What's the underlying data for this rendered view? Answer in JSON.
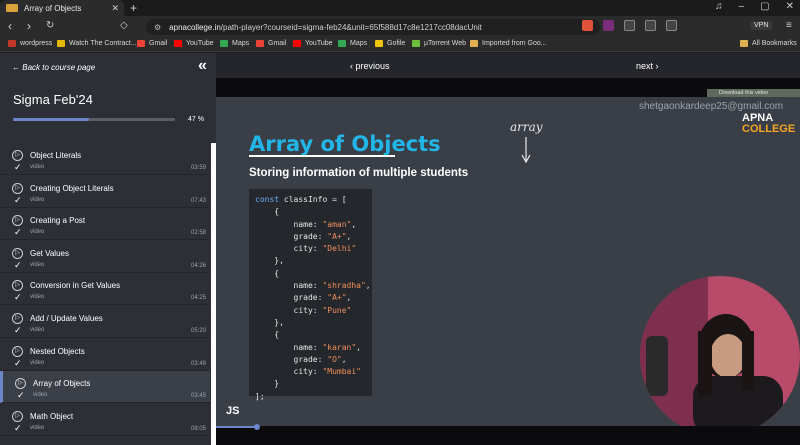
{
  "browser": {
    "tab_title": "Array of Objects",
    "url_host": "apnacollege.in",
    "url_path": "/path-player?courseid=sigma-feb24&unit=65f588d17c8e1217cc08dacUnit",
    "vpn_label": "VPN",
    "bookmarks": [
      {
        "label": "wordpress",
        "color": "#c0392b"
      },
      {
        "label": "Watch The Contract...",
        "color": "#e6b800"
      },
      {
        "label": "Gmail",
        "color": "#ea4335"
      },
      {
        "label": "YouTube",
        "color": "#ff0000"
      },
      {
        "label": "Maps",
        "color": "#34a853"
      },
      {
        "label": "Gmail",
        "color": "#ea4335"
      },
      {
        "label": "YouTube",
        "color": "#ff0000"
      },
      {
        "label": "Maps",
        "color": "#34a853"
      },
      {
        "label": "Gofile",
        "color": "#f1c40f"
      },
      {
        "label": "µTorrent Web",
        "color": "#6fbf3b"
      },
      {
        "label": "Imported from Goo...",
        "color": "#e0b050"
      }
    ],
    "all_bookmarks": "All Bookmarks"
  },
  "sidebar": {
    "back_label": "Back to course page",
    "course_title": "Sigma Feb'24",
    "progress_percent": 47,
    "progress_label": "47 %",
    "items": [
      {
        "title": "Object Literals",
        "kind": "video",
        "duration": "03:59",
        "active": false
      },
      {
        "title": "Creating Object Literals",
        "kind": "video",
        "duration": "07:43",
        "active": false
      },
      {
        "title": "Creating a Post",
        "kind": "video",
        "duration": "02:58",
        "active": false
      },
      {
        "title": "Get Values",
        "kind": "video",
        "duration": "04:26",
        "active": false
      },
      {
        "title": "Conversion in Get Values",
        "kind": "video",
        "duration": "04:25",
        "active": false
      },
      {
        "title": "Add / Update Values",
        "kind": "video",
        "duration": "05:20",
        "active": false
      },
      {
        "title": "Nested Objects",
        "kind": "video",
        "duration": "03:48",
        "active": false
      },
      {
        "title": "Array of Objects",
        "kind": "video",
        "duration": "03:45",
        "active": true
      },
      {
        "title": "Math Object",
        "kind": "video",
        "duration": "08:05",
        "active": false
      }
    ]
  },
  "player": {
    "prev_label": "‹ previous",
    "next_label": "next ›",
    "download_label": "Download this video",
    "seek_fraction": 0.07
  },
  "slide": {
    "email_watermark": "shetgaonkardeep25@gmail.com",
    "logo_line1": "APNA",
    "logo_line2": "COLLEGE",
    "title": "Array of Objects",
    "subtitle": "Storing information of multiple students",
    "handwriting": "array",
    "footer": "JS",
    "code_lines": [
      [
        {
          "t": "const ",
          "c": "kw"
        },
        {
          "t": "classInfo = [",
          "c": ""
        }
      ],
      [
        {
          "t": "    {",
          "c": ""
        }
      ],
      [
        {
          "t": "        name: ",
          "c": ""
        },
        {
          "t": "\"aman\"",
          "c": "st"
        },
        {
          "t": ",",
          "c": ""
        }
      ],
      [
        {
          "t": "        grade: ",
          "c": ""
        },
        {
          "t": "\"A+\"",
          "c": "st"
        },
        {
          "t": ",",
          "c": ""
        }
      ],
      [
        {
          "t": "        city: ",
          "c": ""
        },
        {
          "t": "\"Delhi\"",
          "c": "st"
        }
      ],
      [
        {
          "t": "    },",
          "c": ""
        }
      ],
      [
        {
          "t": "    {",
          "c": ""
        }
      ],
      [
        {
          "t": "        name: ",
          "c": ""
        },
        {
          "t": "\"shradha\"",
          "c": "st"
        },
        {
          "t": ",",
          "c": ""
        }
      ],
      [
        {
          "t": "        grade: ",
          "c": ""
        },
        {
          "t": "\"A+\"",
          "c": "st"
        },
        {
          "t": ",",
          "c": ""
        }
      ],
      [
        {
          "t": "        city: ",
          "c": ""
        },
        {
          "t": "\"Pune\"",
          "c": "st"
        }
      ],
      [
        {
          "t": "    },",
          "c": ""
        }
      ],
      [
        {
          "t": "    {",
          "c": ""
        }
      ],
      [
        {
          "t": "        name: ",
          "c": ""
        },
        {
          "t": "\"karan\"",
          "c": "st"
        },
        {
          "t": ",",
          "c": ""
        }
      ],
      [
        {
          "t": "        grade: ",
          "c": ""
        },
        {
          "t": "\"O\"",
          "c": "st"
        },
        {
          "t": ",",
          "c": ""
        }
      ],
      [
        {
          "t": "        city: ",
          "c": ""
        },
        {
          "t": "\"Mumbai\"",
          "c": "st"
        }
      ],
      [
        {
          "t": "    }",
          "c": ""
        }
      ],
      [
        {
          "t": "];",
          "c": ""
        }
      ]
    ]
  }
}
